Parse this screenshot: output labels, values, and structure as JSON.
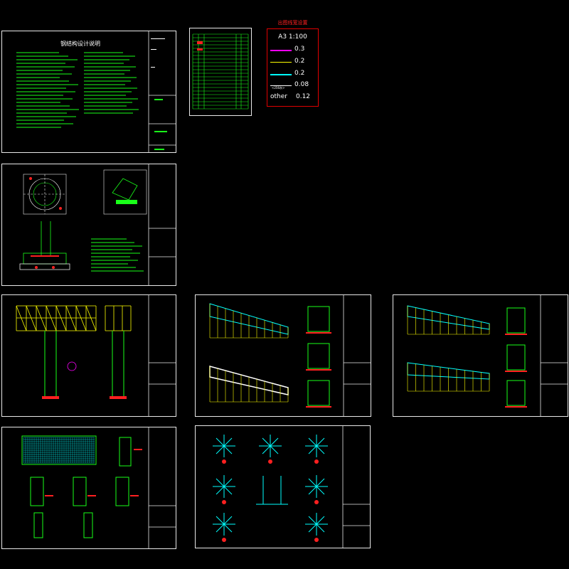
{
  "colors": {
    "background": "#000000",
    "frame": "#e8e8e8",
    "green": "#19ff19",
    "yellow": "#ffff00",
    "cyan": "#00ffff",
    "red": "#ff2020",
    "magenta": "#ff00ff",
    "white": "#ffffff"
  },
  "legend": {
    "title": "出图线宽设置",
    "scale": "A3 1:100",
    "rows": [
      {
        "color": "#ff00ff",
        "value": "0.3",
        "sub": ""
      },
      {
        "color": "#ffff00",
        "value": "0.2",
        "sub": ""
      },
      {
        "color": "#00ffff",
        "value": "0.2",
        "sub": ""
      },
      {
        "color": "#ffffff",
        "value": "0.08",
        "sub": "<256灰>"
      }
    ],
    "other_label": "other",
    "other_value": "0.12"
  },
  "sheets": [
    {
      "name": "design-notes-sheet",
      "title": "钢结构设计说明",
      "kind": "notes"
    },
    {
      "name": "drawing-list-sheet",
      "title": "",
      "kind": "table"
    },
    {
      "name": "foundation-sheet",
      "title": "",
      "kind": "foundation"
    },
    {
      "name": "elevation-sheet",
      "title": "",
      "kind": "elevation"
    },
    {
      "name": "truss-detail-sheet-a",
      "title": "",
      "kind": "truss"
    },
    {
      "name": "truss-detail-sheet-b",
      "title": "",
      "kind": "truss2"
    },
    {
      "name": "panel-detail-sheet",
      "title": "",
      "kind": "panel"
    },
    {
      "name": "node-detail-sheet",
      "title": "",
      "kind": "nodes"
    }
  ]
}
